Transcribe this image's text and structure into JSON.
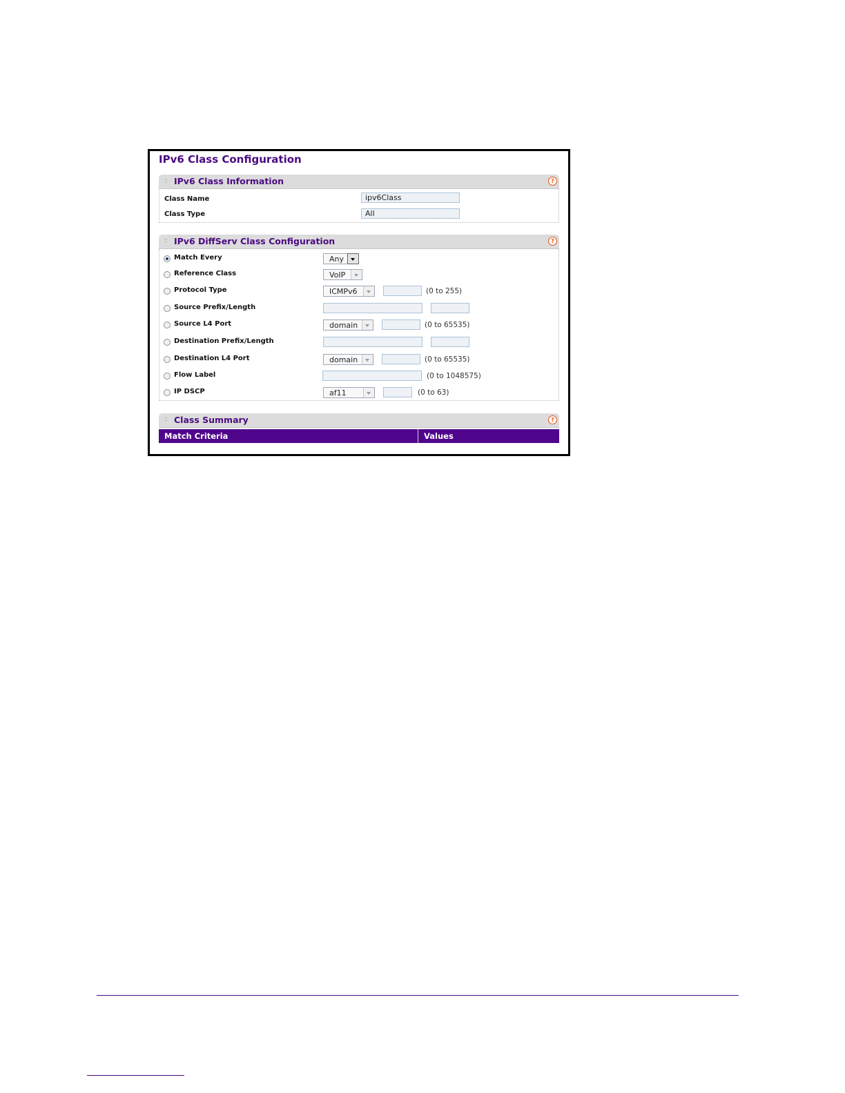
{
  "page_title": "IPv6 Class Configuration",
  "class_info": {
    "title": "IPv6 Class Information",
    "fields": [
      {
        "label": "Class Name",
        "value": "ipv6Class"
      },
      {
        "label": "Class Type",
        "value": "All"
      }
    ]
  },
  "diffserv": {
    "title": "IPv6 DiffServ Class Configuration",
    "rows": [
      {
        "label": "Match Every",
        "selected": true,
        "select": "Any"
      },
      {
        "label": "Reference Class",
        "selected": false,
        "select": "VoIP"
      },
      {
        "label": "Protocol Type",
        "selected": false,
        "select": "ICMPv6",
        "input": "",
        "hint": "(0 to 255)"
      },
      {
        "label": "Source Prefix/Length",
        "selected": false,
        "input1": "",
        "input2": ""
      },
      {
        "label": "Source L4 Port",
        "selected": false,
        "select": "domain",
        "input": "",
        "hint": "(0 to 65535)"
      },
      {
        "label": "Destination Prefix/Length",
        "selected": false,
        "input1": "",
        "input2": ""
      },
      {
        "label": "Destination L4 Port",
        "selected": false,
        "select": "domain",
        "input": "",
        "hint": "(0 to 65535)"
      },
      {
        "label": "Flow Label",
        "selected": false,
        "input": "",
        "hint": "(0 to 1048575)"
      },
      {
        "label": "IP DSCP",
        "selected": false,
        "select": "af11",
        "input": "",
        "hint": "(0 to 63)"
      }
    ]
  },
  "summary": {
    "title": "Class Summary",
    "columns": [
      "Match Criteria",
      "Values"
    ]
  },
  "colors": {
    "accent": "#4b0a82",
    "header_row": "#4f068c",
    "section_bar": "#dcdcdc"
  },
  "icons": {
    "help": "help-icon",
    "grip": "grip-icon"
  }
}
